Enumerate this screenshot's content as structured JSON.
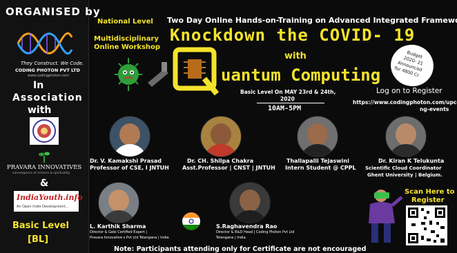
{
  "sidebar": {
    "organised_by": "ORGANISED by",
    "tagline": "They Construct. We Code.",
    "company": "CODING PHOTON PVT LTD",
    "company_url": "www.codingphoton.com",
    "in": "In",
    "association": "Association",
    "with": "with",
    "partner2": "PRAVARA INNOVATIVES",
    "partner2_tag": "convergence of science & spirituality",
    "ampersand": "&",
    "partner3": "IndiaYouth.info",
    "partner3_tag": "An Open Indie Development...",
    "level_line1": "Basic Level",
    "level_line2": "[BL]"
  },
  "header": {
    "national": "National Level",
    "multi1": "Multidisciplinary",
    "multi2": "Online Workshop",
    "subtitle": "Two Day Online Hands-on-Training on Advanced Integrated Frameworks",
    "title": "Knockdown the COVID- 19",
    "with": "with",
    "quantum": "uantum Computing",
    "basic_line": "Basic Level On MAY 23rd & 24th,",
    "year": "2020",
    "time": "10AM-5PM"
  },
  "budget": {
    "l1": "Budget",
    "l2": "2020- 21",
    "l3": "Announced",
    "l4": "for 4800 Cr"
  },
  "register": {
    "label": "Log on to Register",
    "url1": "https://www.codingphoton.com/upco",
    "url2": "ng-events",
    "scan1": "Scan Here to",
    "scan2": "Register"
  },
  "speakers": [
    {
      "name": "Dr. V. Kamakshi Prasad",
      "role": "Professor of CSE, I JNTUH"
    },
    {
      "name": "Dr. CH. Shilpa Chakra",
      "role": "Asst.Professor | CNST | JNTUH"
    },
    {
      "name": "Thallapalli Tejaswini",
      "role": "Intern Student @ CPPL"
    },
    {
      "name": "Dr. Kiran K Telukunta",
      "role1": "Scientific Cloud Coordinator",
      "role2": "Ghent University | Belgium."
    },
    {
      "name": "L. Karthik Sharma",
      "role1": "Director & Gebi Certified Expert |",
      "role2": "Pravara Innovative s Pvt Ltd Telangana | India."
    },
    {
      "name": "S.Raghavendra Rao",
      "role1": "Director & R&D Head | Coding Photon Pvt Ltd",
      "role2": "Telangana | India."
    }
  ],
  "footer": {
    "note": "Note: Participants attending only for Certificate are not encouraged"
  },
  "colors": {
    "accent_yellow": "#f4e32c",
    "background": "#0b0b0c",
    "text_white": "#ffffff"
  },
  "icons": [
    "dna-logo-icon",
    "jntuh-seal-icon",
    "virus-icon",
    "quantum-chip-icon",
    "india-flag-icon",
    "vr-person-icon",
    "qr-code-icon"
  ]
}
